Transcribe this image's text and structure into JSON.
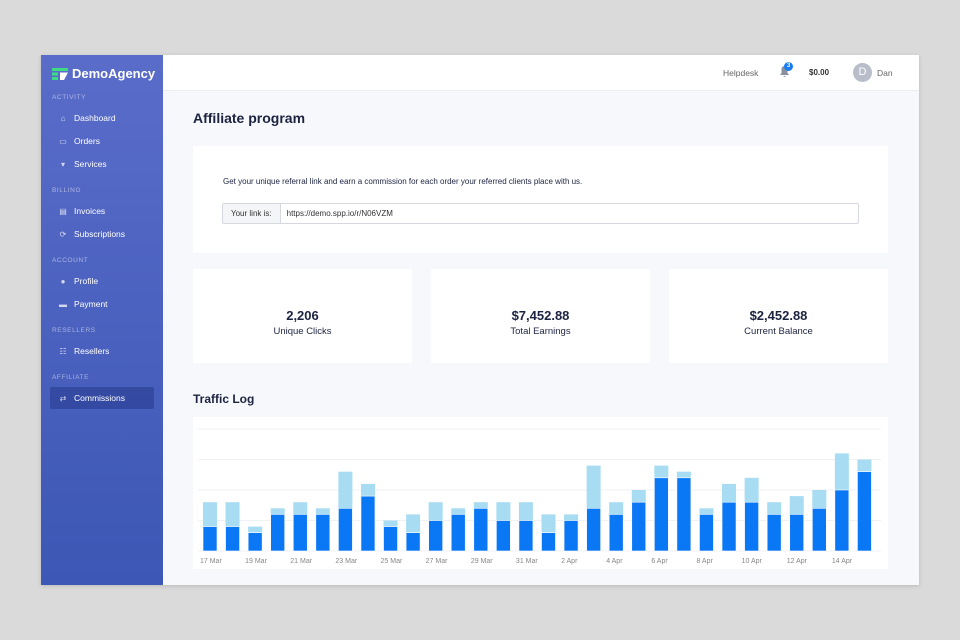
{
  "brand": "DemoAgency",
  "sidebar": {
    "sections": [
      {
        "title": "ACTIVITY",
        "items": [
          {
            "label": "Dashboard",
            "icon": "home-icon"
          },
          {
            "label": "Orders",
            "icon": "inbox-icon"
          },
          {
            "label": "Services",
            "icon": "cart-icon"
          }
        ]
      },
      {
        "title": "BILLING",
        "items": [
          {
            "label": "Invoices",
            "icon": "file-icon"
          },
          {
            "label": "Subscriptions",
            "icon": "refresh-icon"
          }
        ]
      },
      {
        "title": "ACCOUNT",
        "items": [
          {
            "label": "Profile",
            "icon": "user-icon"
          },
          {
            "label": "Payment",
            "icon": "card-icon"
          }
        ]
      },
      {
        "title": "RESELLERS",
        "items": [
          {
            "label": "Resellers",
            "icon": "sitemap-icon"
          }
        ]
      },
      {
        "title": "AFFILIATE",
        "items": [
          {
            "label": "Commissions",
            "icon": "handshake-icon"
          }
        ]
      }
    ]
  },
  "header": {
    "helpdesk": "Helpdesk",
    "notif_count": "3",
    "balance": "$0.00",
    "avatar_letter": "D",
    "user": "Dan"
  },
  "page_title": "Affiliate program",
  "referral": {
    "text": "Get your unique referral link and earn a commission for each order your referred clients place with us.",
    "label": "Your link is:",
    "link": "https://demo.spp.io/r/N06VZM"
  },
  "stats": [
    {
      "value": "2,206",
      "label": "Unique Clicks"
    },
    {
      "value": "$7,452.88",
      "label": "Total Earnings"
    },
    {
      "value": "$2,452.88",
      "label": "Current Balance"
    }
  ],
  "traffic_title": "Traffic Log",
  "chart_data": {
    "type": "bar",
    "stacked": true,
    "categories": [
      "17 Mar",
      "18 Mar",
      "19 Mar",
      "20 Mar",
      "21 Mar",
      "22 Mar",
      "23 Mar",
      "24 Mar",
      "25 Mar",
      "26 Mar",
      "27 Mar",
      "28 Mar",
      "29 Mar",
      "30 Mar",
      "31 Mar",
      "1 Apr",
      "2 Apr",
      "3 Apr",
      "4 Apr",
      "5 Apr",
      "6 Apr",
      "7 Apr",
      "8 Apr",
      "9 Apr",
      "10 Apr",
      "11 Apr",
      "12 Apr",
      "13 Apr",
      "14 Apr",
      "15 Apr"
    ],
    "tick_labels": [
      "17 Mar",
      "19 Mar",
      "21 Mar",
      "23 Mar",
      "25 Mar",
      "27 Mar",
      "29 Mar",
      "31 Mar",
      "2 Apr",
      "4 Apr",
      "6 Apr",
      "8 Apr",
      "10 Apr",
      "12 Apr",
      "14 Apr"
    ],
    "series": [
      {
        "name": "primary",
        "color": "#0a78f5",
        "values": [
          4,
          4,
          3,
          6,
          6,
          6,
          7,
          9,
          4,
          3,
          5,
          6,
          7,
          5,
          5,
          3,
          5,
          7,
          6,
          8,
          12,
          12,
          6,
          8,
          8,
          6,
          6,
          7,
          10,
          13
        ]
      },
      {
        "name": "secondary",
        "color": "#a8dcf2",
        "values": [
          4,
          4,
          1,
          1,
          2,
          1,
          6,
          2,
          1,
          3,
          3,
          1,
          1,
          3,
          3,
          3,
          1,
          7,
          2,
          2,
          2,
          1,
          1,
          3,
          4,
          2,
          3,
          3,
          6,
          2
        ]
      }
    ],
    "ylim": [
      0,
      20
    ],
    "grid": true
  }
}
